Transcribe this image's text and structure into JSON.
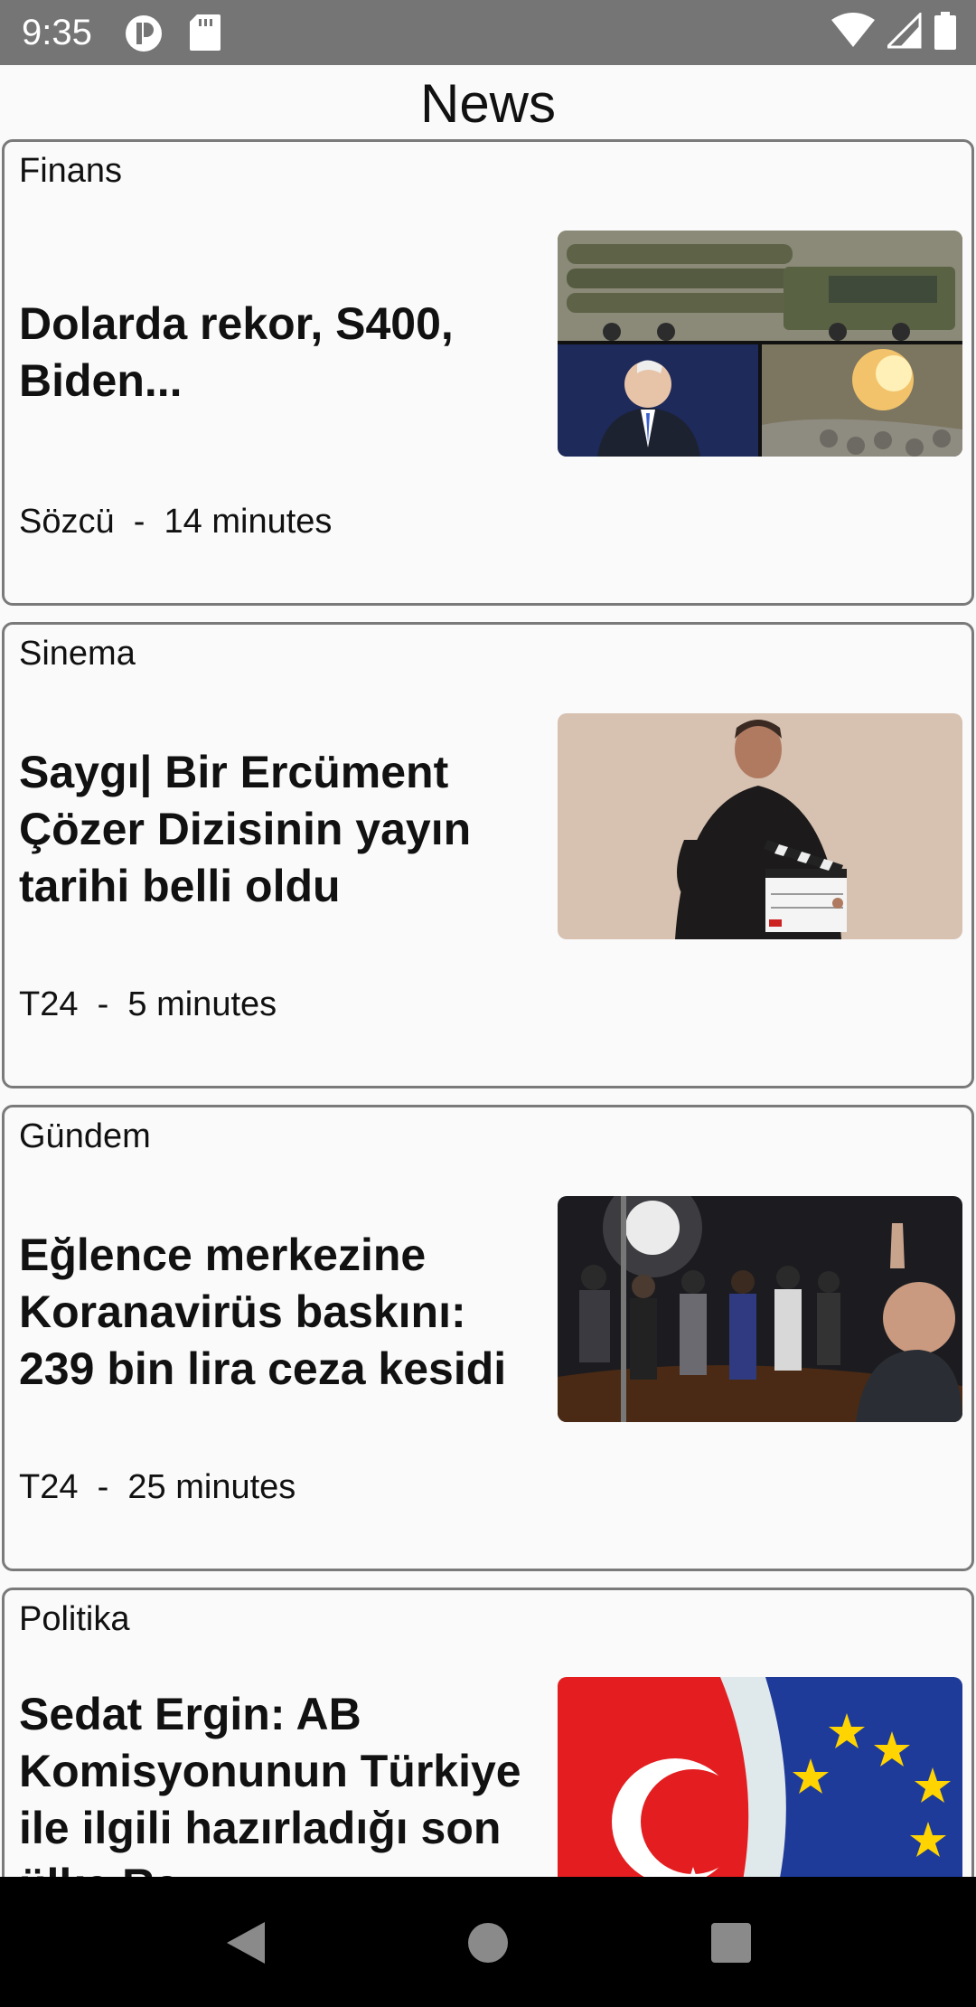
{
  "status_bar": {
    "time": "9:35",
    "left_icons": [
      "app-notification-icon",
      "sd-card-icon"
    ],
    "right_icons": [
      "wifi-icon",
      "cellular-signal-icon",
      "battery-icon"
    ]
  },
  "app": {
    "title": "News"
  },
  "articles": [
    {
      "category": "Finans",
      "headline": "Dolarda rekor, S400, Biden...",
      "source": "Sözcü",
      "separator": "-",
      "time_ago": "14 minutes",
      "image_icon": "news-photo-collage-icon"
    },
    {
      "category": "Sinema",
      "headline": "Saygı| Bir Ercüment Çözer Dizisinin yayın tarihi belli oldu",
      "source": "T24",
      "separator": "-",
      "time_ago": "5 minutes",
      "image_icon": "man-with-clapperboard-photo-icon"
    },
    {
      "category": "Gündem",
      "headline": "Eğlence merkezine Koranavirüs baskını: 239 bin lira ceza kesidi",
      "source": "T24",
      "separator": "-",
      "time_ago": "25 minutes",
      "image_icon": "crowd-at-venue-photo-icon"
    },
    {
      "category": "Politika",
      "headline": "Sedat Ergin: AB Komisyonunun Türkiye ile ilgili hazırladığı son ülke Ra...",
      "image_icon": "turkey-eu-flags-photo-icon"
    }
  ],
  "nav_bar": {
    "buttons": [
      "back-icon",
      "home-icon",
      "recents-icon"
    ]
  },
  "colors": {
    "status_bar": "#757575",
    "background": "#fafafa",
    "card_border": "#7a7a7a",
    "nav_bar": "#000000",
    "text": "#111111"
  }
}
